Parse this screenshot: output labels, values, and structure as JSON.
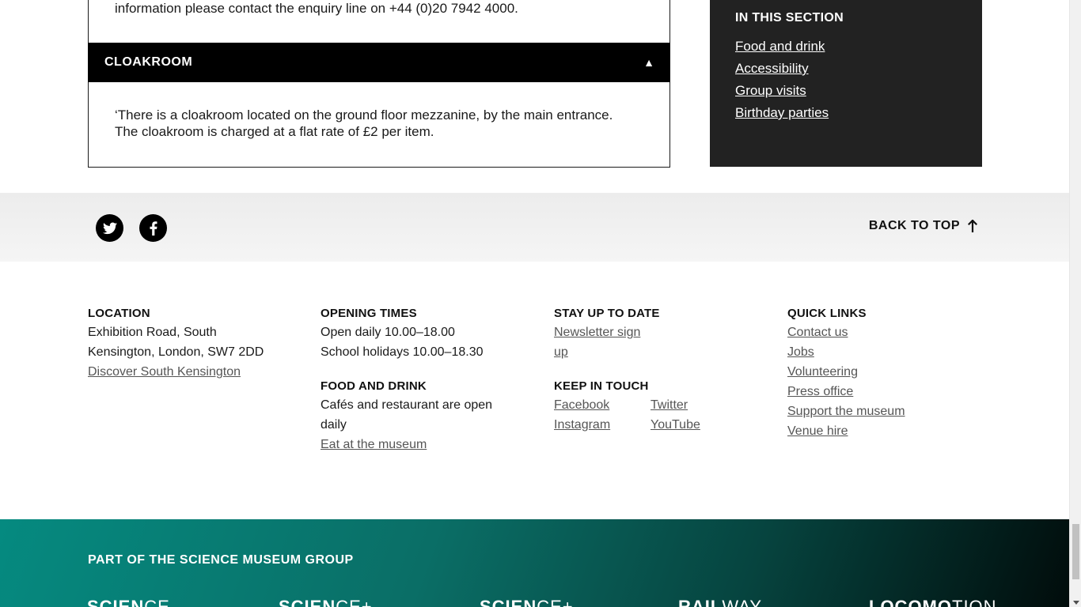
{
  "accordion": {
    "previous_text": "information please contact the enquiry line on +44 (0)20 7942 4000.",
    "cloakroom": {
      "title": "CLOAKROOM",
      "toggle": "▲",
      "body": "‘There is a cloakroom located on the ground floor mezzanine, by the main entrance. The cloakroom is charged at a flat rate of £2 per item."
    }
  },
  "side_panel": {
    "title": "IN THIS SECTION",
    "links": [
      "Food and drink",
      "Accessibility",
      "Group visits",
      "Birthday parties"
    ]
  },
  "social_bar": {
    "icons": [
      "twitter-icon",
      "facebook-icon"
    ],
    "back_to_top": "BACK TO TOP"
  },
  "footer": {
    "location": {
      "heading": "LOCATION",
      "line1": "Exhibition Road, South",
      "line2": "Kensington, London, SW7 2DD",
      "link": "Discover South Kensington"
    },
    "opening_times": {
      "heading": "OPENING TIMES",
      "line1": "Open daily 10.00–18.00",
      "line2": "School holidays 10.00–18.30"
    },
    "food_and_drink": {
      "heading": "FOOD AND DRINK",
      "line1": "Cafés and restaurant are open",
      "line2": "daily",
      "link": "Eat at the museum"
    },
    "stay_up_to_date": {
      "heading": "STAY UP TO DATE",
      "link_line1": "Newsletter sign",
      "link_line2": "up"
    },
    "keep_in_touch": {
      "heading": "KEEP IN TOUCH",
      "links": [
        "Facebook",
        "Twitter",
        "Instagram",
        "YouTube"
      ]
    },
    "quick_links": {
      "heading": "QUICK LINKS",
      "links": [
        "Contact us",
        "Jobs",
        "Volunteering",
        "Press office",
        "Support the museum",
        "Venue hire"
      ]
    }
  },
  "group_banner": {
    "title": "PART OF THE SCIENCE MUSEUM GROUP",
    "logos": [
      {
        "bold": "SCIEN",
        "light": "CE"
      },
      {
        "bold": "SCIEN",
        "light": "CE+"
      },
      {
        "bold": "SCIEN",
        "light": "CE+"
      },
      {
        "bold": "RAIL",
        "light": "WAY"
      },
      {
        "bold": "LOCOMO",
        "light": "TION"
      }
    ]
  }
}
